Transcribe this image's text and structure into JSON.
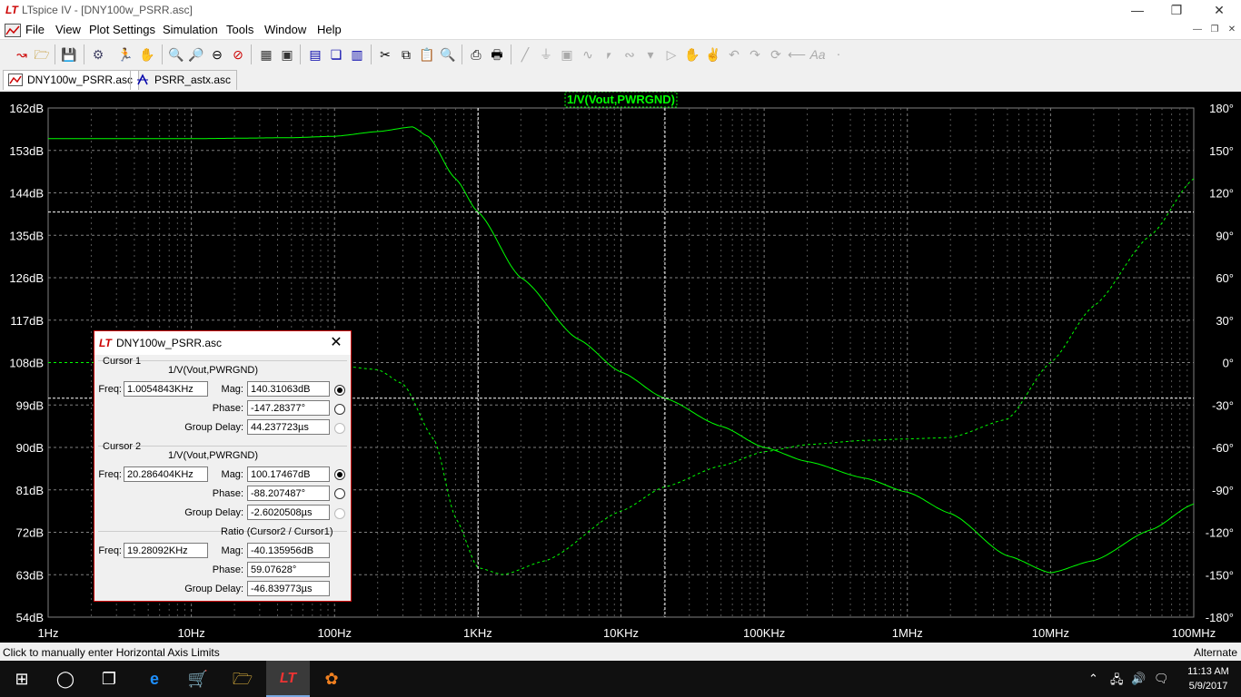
{
  "window": {
    "logo": "LT",
    "title": "LTspice IV - [DNY100w_PSRR.asc]",
    "min_icon": "minimize-icon",
    "max_icon": "maximize-icon",
    "close_icon": "close-icon"
  },
  "menu": {
    "items": [
      "File",
      "View",
      "Plot Settings",
      "Simulation",
      "Tools",
      "Window",
      "Help"
    ]
  },
  "tabs": [
    {
      "label": "DNY100w_PSRR.asc",
      "icon": "waveform-icon",
      "active": true
    },
    {
      "label": "PSRR_astx.asc",
      "icon": "schematic-icon",
      "active": false
    }
  ],
  "chart_data": {
    "type": "line",
    "title": "1/V(Vout,PWRGND)",
    "x_scale": "log",
    "x_ticks": [
      "1Hz",
      "10Hz",
      "100Hz",
      "1KHz",
      "10KHz",
      "100KHz",
      "1MHz",
      "10MHz",
      "100MHz"
    ],
    "xlim": [
      1,
      100000000
    ],
    "y_left_ticks": [
      "162dB",
      "153dB",
      "144dB",
      "135dB",
      "126dB",
      "117dB",
      "108dB",
      "99dB",
      "90dB",
      "81dB",
      "72dB",
      "63dB",
      "54dB"
    ],
    "y_left_lim": [
      54,
      162
    ],
    "y_right_ticks": [
      "180°",
      "150°",
      "120°",
      "90°",
      "60°",
      "30°",
      "0°",
      "-30°",
      "-60°",
      "-90°",
      "-120°",
      "-150°",
      "-180°"
    ],
    "y_right_lim": [
      -180,
      180
    ],
    "grid": true,
    "series": [
      {
        "name": "1/V(Vout,PWRGND)",
        "quantity": "magnitude",
        "axis": "left",
        "style": "solid",
        "color": "#00ff00",
        "x": [
          1,
          10,
          50,
          100,
          200,
          350,
          450,
          700,
          1000,
          2000,
          5000,
          10000,
          20000,
          50000,
          100000,
          200000,
          500000,
          1000000,
          2000000,
          5000000,
          10000000,
          20000000,
          50000000,
          100000000
        ],
        "y": [
          155.5,
          155.5,
          155.7,
          156,
          157,
          158,
          156,
          147,
          140,
          126,
          113,
          106,
          100.5,
          94.5,
          90,
          87,
          83.5,
          80.5,
          76,
          67,
          63.4,
          66,
          72.5,
          78
        ]
      },
      {
        "name": "1/V(Vout,PWRGND)",
        "quantity": "phase",
        "axis": "right",
        "style": "dashed",
        "color": "#00ff00",
        "x": [
          1,
          10,
          100,
          200,
          300,
          500,
          700,
          1000,
          1500,
          3000,
          10000,
          20000,
          50000,
          100000,
          200000,
          500000,
          1000000,
          2000000,
          5000000,
          10000000,
          20000000,
          50000000,
          100000000
        ],
        "y": [
          0,
          0,
          -2,
          -5,
          -15,
          -55,
          -110,
          -145,
          -150,
          -140,
          -105,
          -88,
          -73,
          -63,
          -58,
          -55,
          -54,
          -53,
          -40,
          0,
          40,
          90,
          130
        ]
      }
    ],
    "cursors": [
      {
        "x": 1005.4843,
        "label": "1"
      },
      {
        "x": 20286.404,
        "label": "2"
      }
    ]
  },
  "dialog": {
    "title": "DNY100w_PSRR.asc",
    "cursor1": {
      "group": "Cursor 1",
      "trace": "1/V(Vout,PWRGND)",
      "freq_label": "Freq:",
      "freq": "1.0054843KHz",
      "mag_label": "Mag:",
      "mag": "140.31063dB",
      "phase_label": "Phase:",
      "phase": "-147.28377°",
      "gd_label": "Group Delay:",
      "gd": "44.237723µs"
    },
    "cursor2": {
      "group": "Cursor 2",
      "trace": "1/V(Vout,PWRGND)",
      "freq_label": "Freq:",
      "freq": "20.286404KHz",
      "mag_label": "Mag:",
      "mag": "100.17467dB",
      "phase_label": "Phase:",
      "phase": "-88.207487°",
      "gd_label": "Group Delay:",
      "gd": "-2.6020508µs"
    },
    "ratio": {
      "group": "Ratio (Cursor2 / Cursor1)",
      "freq_label": "Freq:",
      "freq": "19.28092KHz",
      "mag_label": "Mag:",
      "mag": "-40.135956dB",
      "phase_label": "Phase:",
      "phase": "59.07628°",
      "gd_label": "Group Delay:",
      "gd": "-46.839773µs"
    }
  },
  "status": {
    "left": "Click to manually enter Horizontal Axis Limits",
    "right": "Alternate"
  },
  "taskbar": {
    "time": "11:13 AM",
    "date": "5/9/2017"
  },
  "colors": {
    "plot_bg": "#000000",
    "trace": "#00ff00",
    "grid": "#7f7f7f",
    "axis_text": "#ffffff",
    "cursor": "#ffffff"
  }
}
